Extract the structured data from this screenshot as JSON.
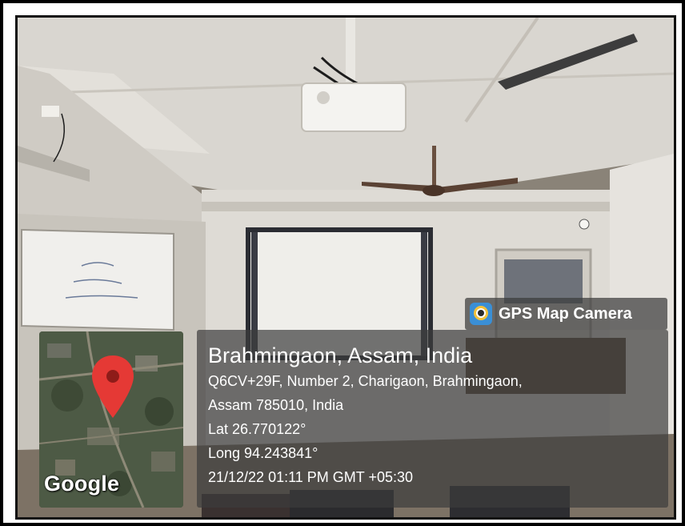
{
  "overlay": {
    "app_label": "GPS Map Camera",
    "app_icon": "gps-map-camera-icon",
    "place_title": "Brahmingaon, Assam, India",
    "address_line1": "Q6CV+29F, Number 2, Charigaon, Brahmingaon,",
    "address_line2": "Assam 785010, India",
    "latitude": "Lat 26.770122°",
    "longitude": "Long 94.243841°",
    "timestamp": "21/12/22 01:11 PM GMT +05:30"
  },
  "map": {
    "attribution": "Google",
    "pin_icon": "map-pin-icon",
    "pin_color": "#e53935"
  },
  "colors": {
    "overlay_bg": "#3c3c3c",
    "frame_border": "#000000"
  }
}
